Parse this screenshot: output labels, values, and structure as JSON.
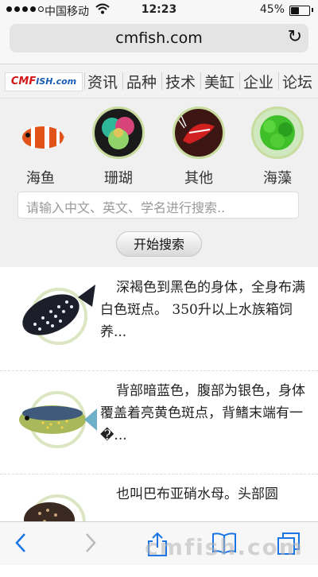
{
  "status_bar": {
    "carrier": "中国移动",
    "time": "12:23",
    "battery_percent": "45%",
    "battery_level": 0.45
  },
  "browser": {
    "url": "cmfish.com",
    "reload_icon": "reload-icon"
  },
  "site": {
    "logo": {
      "part1": "CMF",
      "part2": "ISH.com"
    },
    "nav": [
      "资讯",
      "品种",
      "技术",
      "美缸",
      "企业",
      "论坛"
    ]
  },
  "categories": [
    {
      "label": "海鱼",
      "icon": "clownfish"
    },
    {
      "label": "珊瑚",
      "icon": "coral"
    },
    {
      "label": "其他",
      "icon": "shrimp"
    },
    {
      "label": "海藻",
      "icon": "seaweed"
    }
  ],
  "search": {
    "placeholder": "请输入中文、英文、学名进行搜索..",
    "button": "开始搜索"
  },
  "list": [
    {
      "text": "深褐色到黑色的身体，全身布满白色斑点。 350升以上水族箱饲养..."
    },
    {
      "text": "背部暗蓝色，腹部为银色，身体覆盖着亮黄色斑点，背鳍末端有一�..."
    },
    {
      "text": "也叫巴布亚硝水母。头部圆"
    }
  ],
  "toolbar": {
    "icons": [
      "back-icon",
      "forward-icon",
      "share-icon",
      "bookmarks-icon",
      "tabs-icon"
    ]
  },
  "watermark": "cmfish.com"
}
